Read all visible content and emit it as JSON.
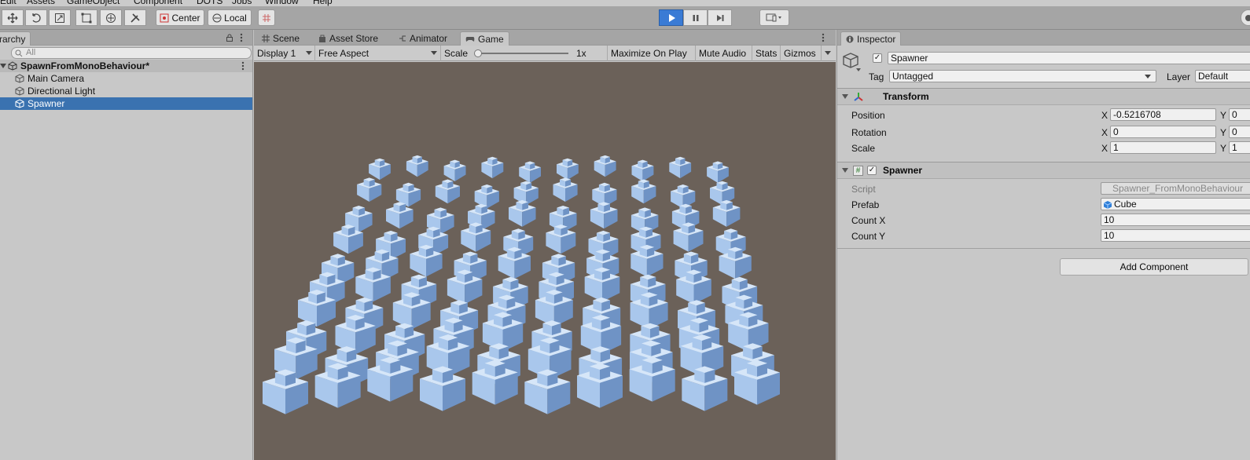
{
  "menu": [
    "Edit",
    "Assets",
    "GameObject",
    "Component",
    "DOTS",
    "Jobs",
    "Window",
    "Help"
  ],
  "toolbar": {
    "pivot_label": "Center",
    "space_label": "Local"
  },
  "hierarchy": {
    "tab_label": "rarchy",
    "search_placeholder": "All",
    "scene_name": "SpawnFromMonoBehaviour*",
    "items": [
      {
        "label": "Main Camera"
      },
      {
        "label": "Directional Light"
      },
      {
        "label": "Spawner"
      }
    ]
  },
  "center_tabs": [
    "Scene",
    "Asset Store",
    "Animator",
    "Game"
  ],
  "game": {
    "display": "Display 1",
    "aspect": "Free Aspect",
    "scale_label": "Scale",
    "scale_value": "1x",
    "maximize": "Maximize On Play",
    "mute": "Mute Audio",
    "stats": "Stats",
    "gizmos": "Gizmos"
  },
  "inspector": {
    "tab_label": "Inspector",
    "object_name": "Spawner",
    "tag_label": "Tag",
    "tag_value": "Untagged",
    "layer_label": "Layer",
    "layer_value": "Default",
    "transform": {
      "title": "Transform",
      "position_label": "Position",
      "rotation_label": "Rotation",
      "scale_label": "Scale",
      "x_label": "X",
      "y_label": "Y",
      "position_x": "-0.5216708",
      "rotation_x": "0",
      "scale_x": "1",
      "position_y": "0",
      "rotation_y": "0",
      "scale_y": "1"
    },
    "spawner": {
      "title": "Spawner",
      "script_label": "Script",
      "script_value": "Spawner_FromMonoBehaviour",
      "prefab_label": "Prefab",
      "prefab_value": "Cube",
      "countx_label": "Count X",
      "countx_value": "10",
      "county_label": "Count Y",
      "county_value": "10"
    },
    "add_component": "Add Component"
  },
  "colors": {
    "play_active": "#3a7bd5",
    "selection": "#3a72b0",
    "viewport_bg": "#6b6159",
    "cube_top": "#d6e6f8",
    "cube_left": "#a9c7ec",
    "cube_right": "#6f93c5"
  }
}
